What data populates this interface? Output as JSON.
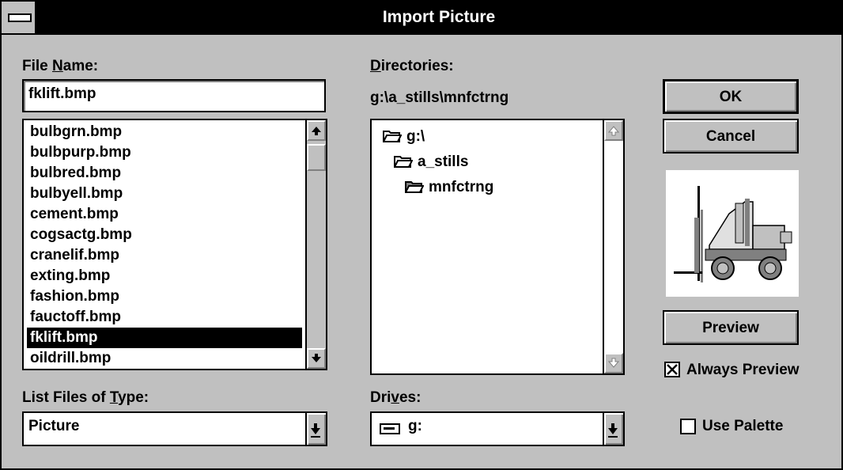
{
  "window": {
    "title": "Import Picture"
  },
  "file_name": {
    "label_pre": "File ",
    "label_key": "N",
    "label_post": "ame:",
    "value": "fklift.bmp"
  },
  "files": [
    {
      "name": "bulbgrn.bmp"
    },
    {
      "name": "bulbpurp.bmp"
    },
    {
      "name": "bulbred.bmp"
    },
    {
      "name": "bulbyell.bmp"
    },
    {
      "name": "cement.bmp"
    },
    {
      "name": "cogsactg.bmp"
    },
    {
      "name": "cranelif.bmp"
    },
    {
      "name": "exting.bmp"
    },
    {
      "name": "fashion.bmp"
    },
    {
      "name": "fauctoff.bmp"
    },
    {
      "name": "fklift.bmp",
      "selected": true
    },
    {
      "name": "oildrill.bmp"
    }
  ],
  "directories": {
    "label_key": "D",
    "label_post": "irectories:",
    "path": "g:\\a_stills\\mnfctrng",
    "tree": [
      {
        "name": "g:\\",
        "state": "open"
      },
      {
        "name": "a_stills",
        "state": "open"
      },
      {
        "name": "mnfctrng",
        "state": "current"
      }
    ]
  },
  "file_type": {
    "label_pre": "List Files of ",
    "label_key": "T",
    "label_post": "ype:",
    "value": "Picture"
  },
  "drives": {
    "label_pre": "Dri",
    "label_key": "v",
    "label_post": "es:",
    "value": "g:"
  },
  "buttons": {
    "ok": "OK",
    "cancel": "Cancel",
    "preview": "Preview"
  },
  "options": {
    "always_preview": {
      "label": "Always Preview",
      "checked": true
    },
    "use_palette": {
      "label": "Use Palette",
      "checked": false
    }
  },
  "icons": {
    "scroll_up": "up-arrow-icon",
    "scroll_down": "down-arrow-icon",
    "dropdown": "dropdown-arrow-icon",
    "folder": "folder-icon",
    "drive": "drive-icon",
    "preview": "forklift-picture"
  }
}
